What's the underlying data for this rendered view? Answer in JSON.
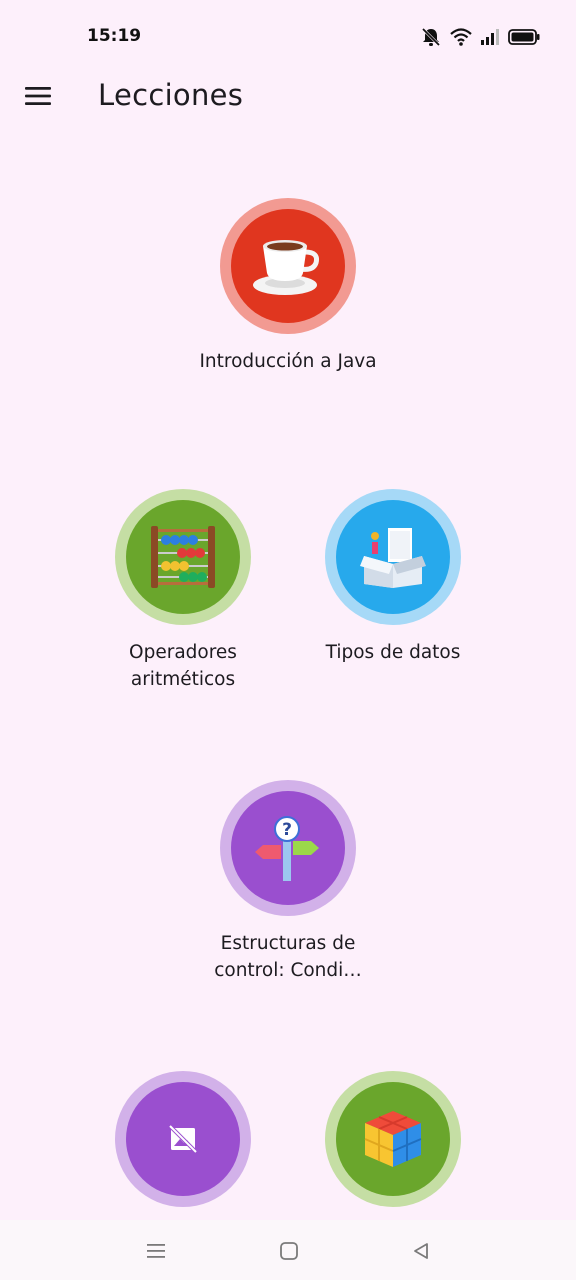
{
  "status_bar": {
    "time": "15:19",
    "icons": [
      "mute-icon",
      "wifi-icon",
      "signal-icon",
      "battery-icon"
    ]
  },
  "app_bar": {
    "menu_icon": "hamburger-menu-icon",
    "title": "Lecciones"
  },
  "lessons": [
    {
      "label": "Introducción a Java",
      "icon": "coffee-cup-icon",
      "disc_color": "#e0361f",
      "ring_color": "#f29a92"
    },
    {
      "label": "Operadores aritméticos",
      "icon": "abacus-icon",
      "disc_color": "#6aa62c",
      "ring_color": "#c5dea4"
    },
    {
      "label": "Tipos de datos",
      "icon": "data-box-icon",
      "disc_color": "#27a9ec",
      "ring_color": "#a6d9f7"
    },
    {
      "label": "Estructuras de control: Condi…",
      "icon": "signpost-question-icon",
      "disc_color": "#9a4fcf",
      "ring_color": "#d2b1e9"
    },
    {
      "label": "",
      "icon": "image-unavailable-icon",
      "disc_color": "#9a4fcf",
      "ring_color": "#d2b1e9"
    },
    {
      "label": "",
      "icon": "cube-icon",
      "disc_color": "#6aa62c",
      "ring_color": "#c5dea4"
    }
  ],
  "nav_bar": {
    "icons": [
      "recent-apps-icon",
      "home-icon",
      "back-icon"
    ]
  }
}
